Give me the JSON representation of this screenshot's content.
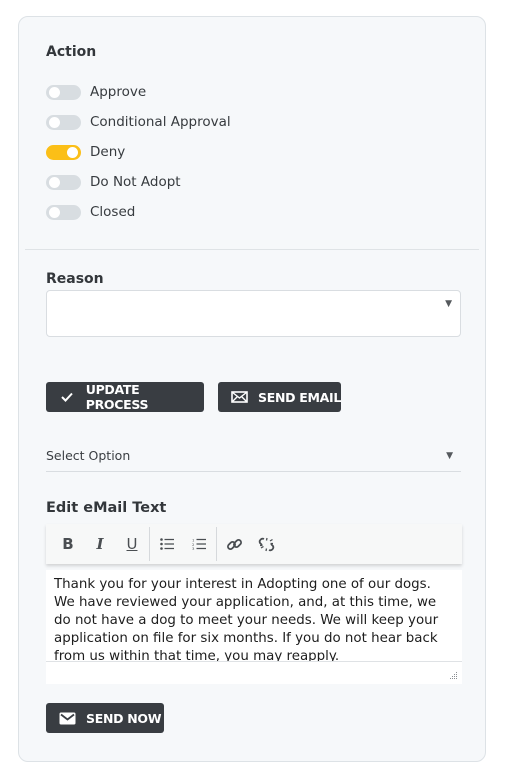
{
  "action": {
    "title": "Action",
    "options": [
      {
        "label": "Approve",
        "checked": false
      },
      {
        "label": "Conditional Approval",
        "checked": false
      },
      {
        "label": "Deny",
        "checked": true
      },
      {
        "label": "Do Not Adopt",
        "checked": false
      },
      {
        "label": "Closed",
        "checked": false
      }
    ]
  },
  "reason": {
    "title": "Reason",
    "value": "",
    "caret_icon": "caret-down-icon"
  },
  "buttons": {
    "update_process": {
      "label": "UPDATE PROCESS",
      "icon": "checkmark-icon"
    },
    "send_email": {
      "label": "SEND EMAIL",
      "icon": "envelope-icon"
    }
  },
  "option_select": {
    "value": "Select Option",
    "caret_icon": "caret-down-icon"
  },
  "email_editor": {
    "title": "Edit eMail Text",
    "toolbar": [
      "bold-icon",
      "italic-icon",
      "underline-icon",
      "bullet-list-icon",
      "numbered-list-icon",
      "link-icon",
      "unlink-icon"
    ],
    "body": "Thank you for your interest in Adopting one of our dogs. We have reviewed your application, and, at this time, we do not have a dog to meet your needs. We will keep your application on file for six months. If you do not hear back from us within that time, you may reapply."
  },
  "send_now": {
    "label": "SEND NOW",
    "icon": "envelope-icon"
  },
  "colors": {
    "toggle_on": "#fbbf17",
    "toggle_off": "#d8dde1",
    "button_bg": "#393d42",
    "card_bg": "#f6f8fa"
  }
}
